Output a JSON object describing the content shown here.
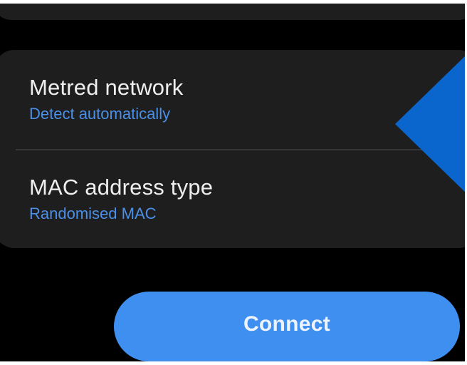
{
  "settings": {
    "metred_network": {
      "title": "Metred network",
      "value": "Detect automatically"
    },
    "mac_address_type": {
      "title": "MAC address type",
      "value": "Randomised MAC"
    }
  },
  "actions": {
    "connect_label": "Connect"
  },
  "icons": {
    "pointer": "arrow-left-icon"
  },
  "colors": {
    "background": "#000000",
    "card": "#1e1e1e",
    "title_text": "#eeeeee",
    "accent_text": "#4a8fe8",
    "button": "#3f8ff0",
    "pointer": "#0a66cc"
  }
}
